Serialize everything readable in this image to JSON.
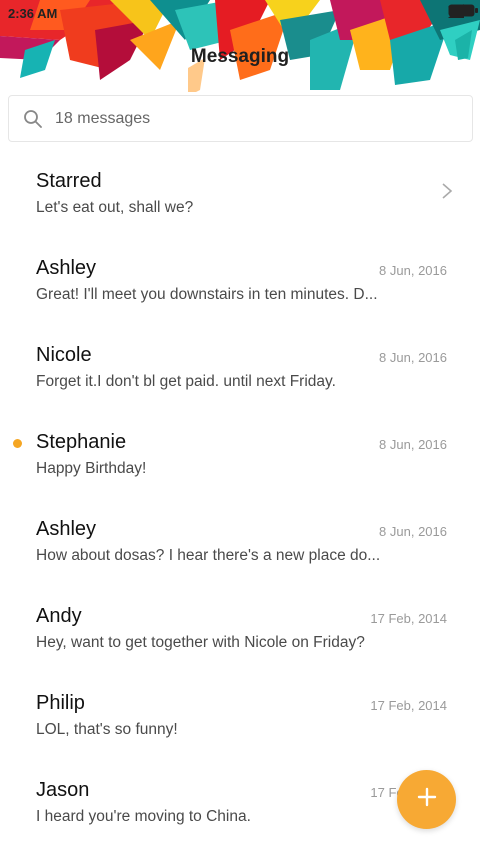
{
  "status": {
    "time": "2:36 AM"
  },
  "header": {
    "title": "Messaging"
  },
  "search": {
    "placeholder": "18 messages"
  },
  "conversations": [
    {
      "name": "Starred",
      "preview": "Let's eat out, shall we?",
      "date": "",
      "unread": false,
      "chevron": true
    },
    {
      "name": "Ashley",
      "preview": "Great! I'll meet you downstairs in ten minutes. D...",
      "date": "8 Jun, 2016",
      "unread": false
    },
    {
      "name": "Nicole",
      "preview": "Forget it.I don't bl get paid. until next Friday.",
      "date": "8 Jun, 2016",
      "unread": false
    },
    {
      "name": "Stephanie",
      "preview": "Happy Birthday!",
      "date": "8 Jun, 2016",
      "unread": true
    },
    {
      "name": "Ashley",
      "preview": "How about dosas? I hear there's a new place do...",
      "date": "8 Jun, 2016",
      "unread": false
    },
    {
      "name": "Andy",
      "preview": "Hey, want to get together with Nicole on Friday?",
      "date": "17 Feb, 2014",
      "unread": false
    },
    {
      "name": "Philip",
      "preview": "LOL, that's so funny!",
      "date": "17 Feb, 2014",
      "unread": false
    },
    {
      "name": "Jason",
      "preview": "I heard you're moving to China.",
      "date": "17 Feb, 2014",
      "unread": false
    }
  ],
  "fab": {
    "icon": "plus-icon",
    "color": "#f7a934"
  },
  "colors": {
    "accent": "#f5a623",
    "date": "#9a9a9a"
  },
  "icons": {
    "search": "search-icon",
    "wifi": "wifi-icon",
    "signal": "signal-icon",
    "battery": "battery-icon",
    "more": "more-dots-icon",
    "chevron": "chevron-right-icon"
  }
}
